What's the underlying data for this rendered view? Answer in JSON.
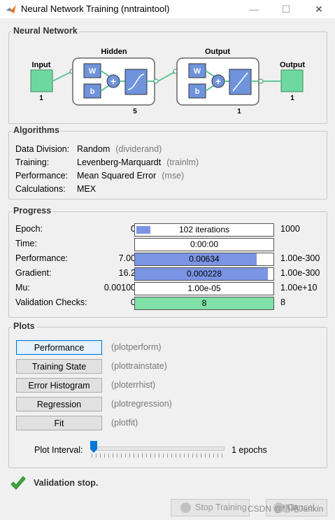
{
  "window": {
    "title": "Neural Network Training (nntraintool)",
    "controls": {
      "minimize": "—",
      "maximize": "☐",
      "close": "✕"
    }
  },
  "network": {
    "section_title": "Neural Network",
    "input_label": "Input",
    "input_size": "1",
    "hidden_label": "Hidden",
    "hidden_size": "5",
    "output_layer_label": "Output",
    "output_layer_size": "1",
    "output_label": "Output",
    "output_size": "1",
    "w_label": "W",
    "b_label": "b",
    "w2_label": "W",
    "b2_label": "b",
    "colors": {
      "node": "#6fd8a0",
      "block": "#6f93dc",
      "wire": "#5ec79a"
    }
  },
  "algorithms": {
    "section_title": "Algorithms",
    "rows": [
      {
        "label": "Data Division:",
        "value": "Random",
        "fn": "(dividerand)"
      },
      {
        "label": "Training:",
        "value": "Levenberg-Marquardt",
        "fn": "(trainlm)"
      },
      {
        "label": "Performance:",
        "value": "Mean Squared Error",
        "fn": "(mse)"
      },
      {
        "label": "Calculations:",
        "value": "MEX",
        "fn": ""
      }
    ]
  },
  "progress": {
    "section_title": "Progress",
    "rows": [
      {
        "label": "Epoch:",
        "start": "0",
        "text": "102 iterations",
        "end": "1000",
        "fill": 0.102
      },
      {
        "label": "Time:",
        "start": "",
        "text": "0:00:00",
        "end": "",
        "fill": 0
      },
      {
        "label": "Performance:",
        "start": "7.00",
        "text": "0.00634",
        "end": "1.00e-300",
        "fill": 0.88
      },
      {
        "label": "Gradient:",
        "start": "16.2",
        "text": "0.000228",
        "end": "1.00e-300",
        "fill": 0.96
      },
      {
        "label": "Mu:",
        "start": "0.00100",
        "text": "1.00e-05",
        "end": "1.00e+10",
        "fill": 0
      },
      {
        "label": "Validation Checks:",
        "start": "0",
        "text": "8",
        "end": "8",
        "fill": 1.0
      }
    ]
  },
  "plots": {
    "section_title": "Plots",
    "buttons": [
      {
        "label": "Performance",
        "fn": "(plotperform)"
      },
      {
        "label": "Training State",
        "fn": "(plottrainstate)"
      },
      {
        "label": "Error Histogram",
        "fn": "(ploterrhist)"
      },
      {
        "label": "Regression",
        "fn": "(plotregression)"
      },
      {
        "label": "Fit",
        "fn": "(plotfit)"
      }
    ],
    "interval_label": "Plot Interval:",
    "interval_value": "1 epochs",
    "interval_level": 0
  },
  "status": {
    "text": "Validation stop."
  },
  "bottom": {
    "stop_label": "Stop Training",
    "cancel_label": "Cancel",
    "watermark": "CSDN @悟略Jankin"
  }
}
